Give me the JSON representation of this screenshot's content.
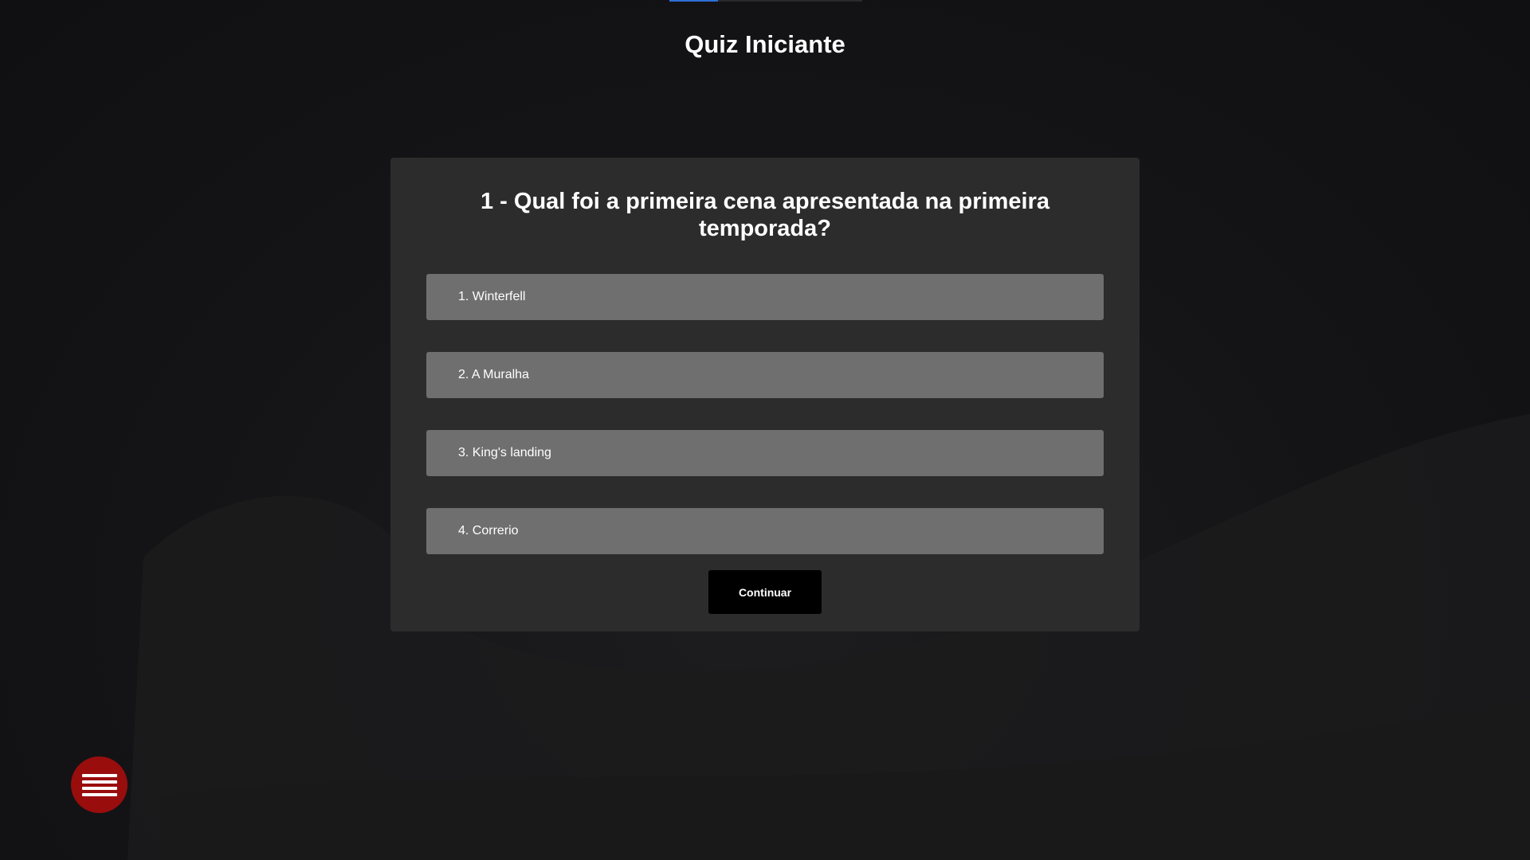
{
  "header": {
    "title": "Quiz Iniciante",
    "progress": 0.25
  },
  "quiz": {
    "question": "1 - Qual foi a primeira cena apresentada na primeira temporada?",
    "answers": [
      {
        "label": "1. Winterfell"
      },
      {
        "label": "2. A Muralha"
      },
      {
        "label": "3. King's landing"
      },
      {
        "label": "4. Correrio"
      }
    ],
    "continue_label": "Continuar"
  },
  "menu": {
    "icon": "hamburger-menu-icon"
  },
  "colors": {
    "background": "#141416",
    "card": "#2c2c2d",
    "answer": "#6f6f6f",
    "button": "#000000",
    "menu_fab": "#9a0d0d",
    "progress": "#2f6fd6"
  }
}
